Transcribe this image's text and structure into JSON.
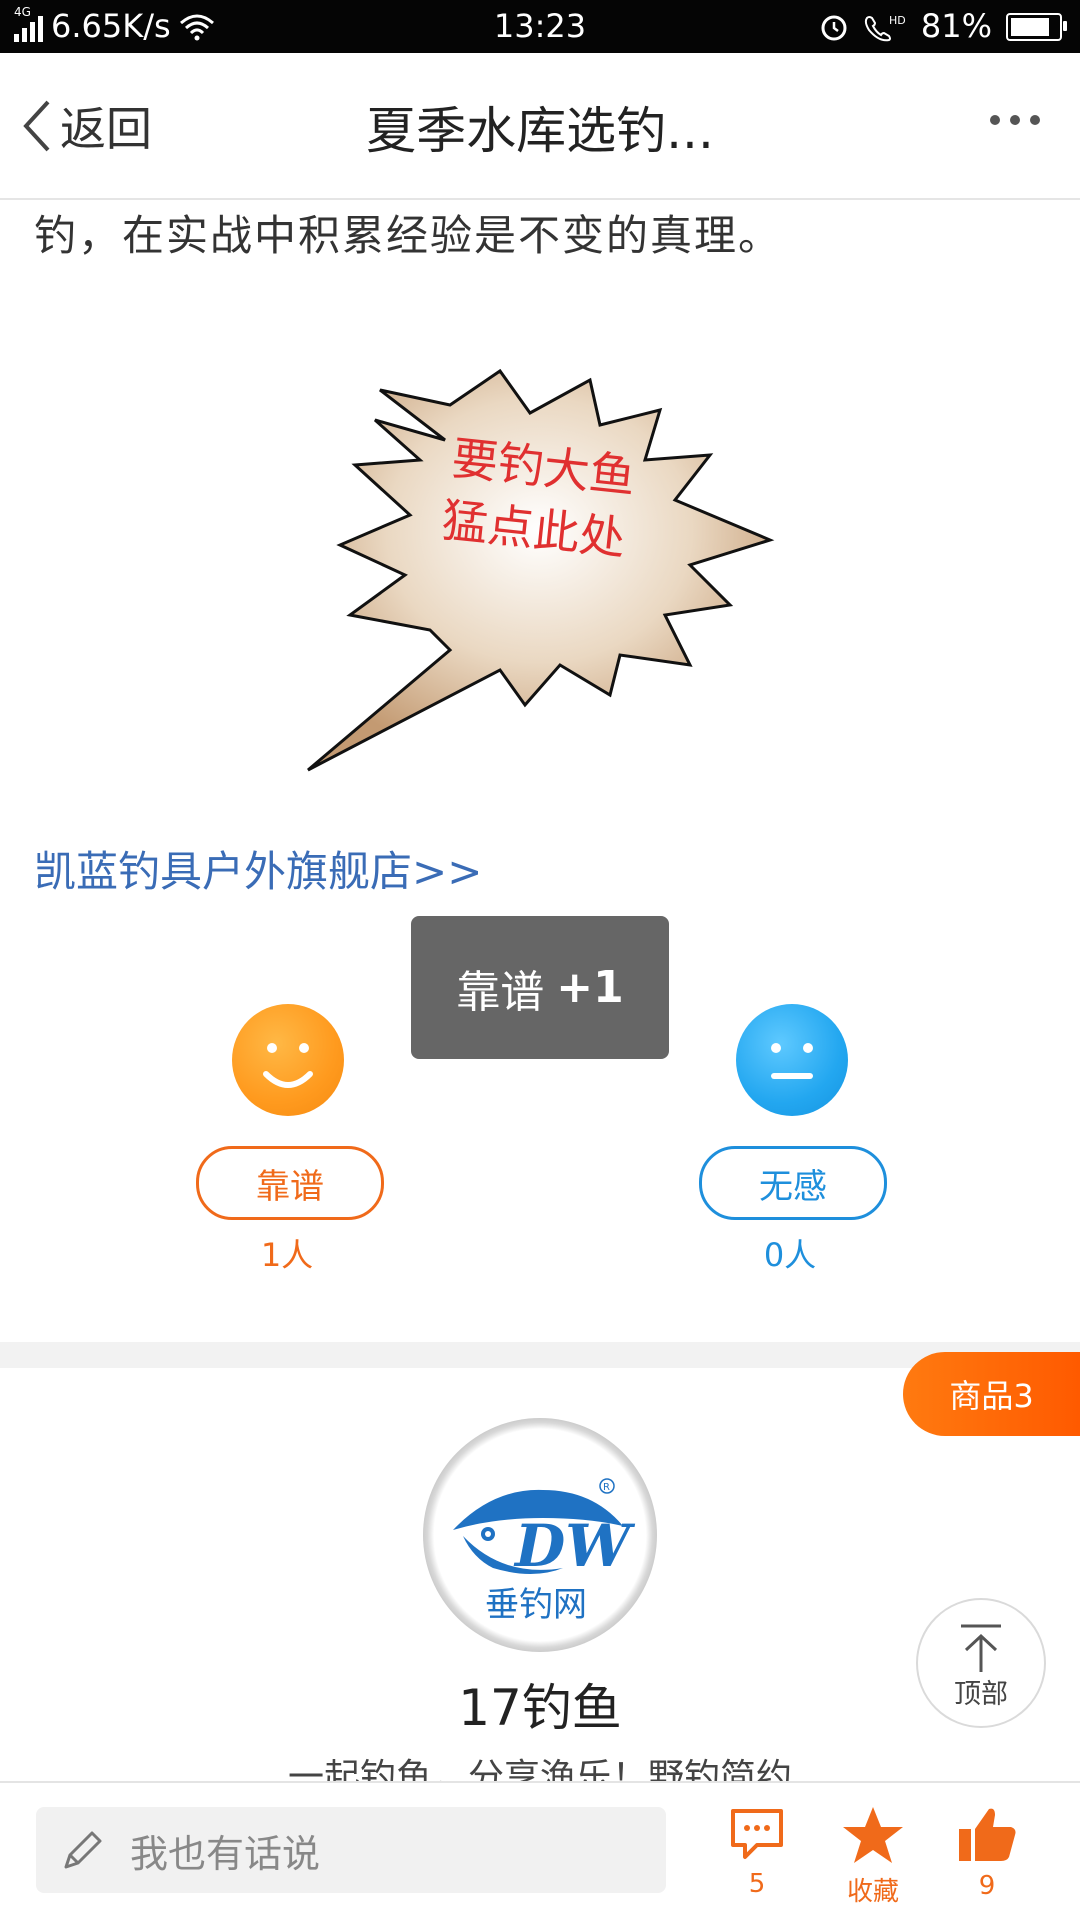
{
  "status_bar": {
    "network": "4G",
    "speed": "6.65K/s",
    "time": "13:23",
    "battery": "81%"
  },
  "header": {
    "back_label": "返回",
    "title": "夏季水库选钓..."
  },
  "article": {
    "text_line": "钓，在实战中积累经验是不变的真理。",
    "promo_image_line1": "要钓大鱼",
    "promo_image_line2": "猛点此处",
    "shop_link": "凯蓝钓具户外旗舰店>>"
  },
  "toast": {
    "label": "靠谱",
    "plus": "+1"
  },
  "votes": {
    "good_label": "靠谱",
    "good_count": "1人",
    "none_label": "无感",
    "none_count": "0人"
  },
  "goods_tab": "商品3",
  "author": {
    "logo_letters": "DW",
    "logo_text": "垂钓网",
    "name": "17钓鱼",
    "tagline": "一起钓鱼，分享渔乐！野钓简约"
  },
  "back_to_top": "顶部",
  "bottom_bar": {
    "input_placeholder": "我也有话说",
    "comment_count": "5",
    "favorite_label": "收藏",
    "like_count": "9"
  },
  "colors": {
    "accent_orange": "#f06a1a",
    "accent_blue": "#1e8fdc",
    "link_blue": "#3a6cb6",
    "toast_bg": "#666666"
  }
}
